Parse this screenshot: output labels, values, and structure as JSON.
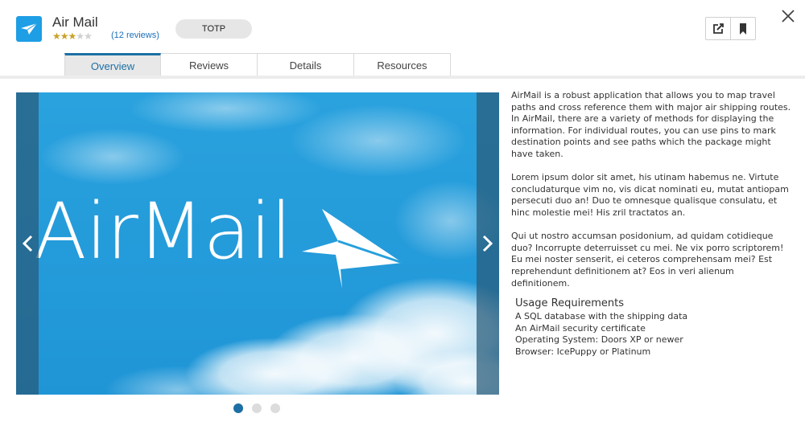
{
  "app": {
    "title": "Air Mail",
    "rating": 3,
    "rating_max": 5,
    "reviews_label": "(12 reviews)",
    "tag": "TOTP"
  },
  "actions": {
    "open_icon": "external-edit-icon",
    "bookmark_icon": "bookmark-icon",
    "close_icon": "close-icon"
  },
  "tabs": [
    {
      "label": "Overview",
      "active": true
    },
    {
      "label": "Reviews",
      "active": false
    },
    {
      "label": "Details",
      "active": false
    },
    {
      "label": "Resources",
      "active": false
    }
  ],
  "carousel": {
    "hero_text": "AirMail",
    "slide_count": 3,
    "active_slide": 1
  },
  "description": {
    "para1": "AirMail is a robust application that allows you to map travel paths and cross reference them with major air shipping routes.",
    "para1b": "In AirMail, there are a variety of methods for displaying the information. For individual routes, you can use pins to mark destination points and see paths which the package might have taken.",
    "para2": "Lorem ipsum dolor sit amet, his utinam habemus ne. Virtute concludaturque vim no, vis dicat nominati eu, mutat antiopam persecuti duo an! Duo te omnesque qualisque consulatu, et hinc molestie mei! His zril tractatos an.",
    "para3": "Qui ut nostro accumsan posidonium, ad quidam cotidieque duo? Incorrupte deterruisset cu mei. Ne vix porro scriptorem! Eu mei noster senserit, ei ceteros comprehensam mei? Est reprehendunt  definitionem at? Eos in veri alienum definitionem."
  },
  "requirements": {
    "title": "Usage Requirements",
    "items": [
      "A SQL database with the shipping data",
      "An AirMail security certificate",
      "Operating System: Doors XP or newer",
      "Browser: IcePuppy or Platinum"
    ]
  },
  "colors": {
    "accent": "#1d6fa5",
    "icon_bg": "#1e9ee5",
    "star": "#c9a227",
    "sky": "#27a0dc"
  }
}
